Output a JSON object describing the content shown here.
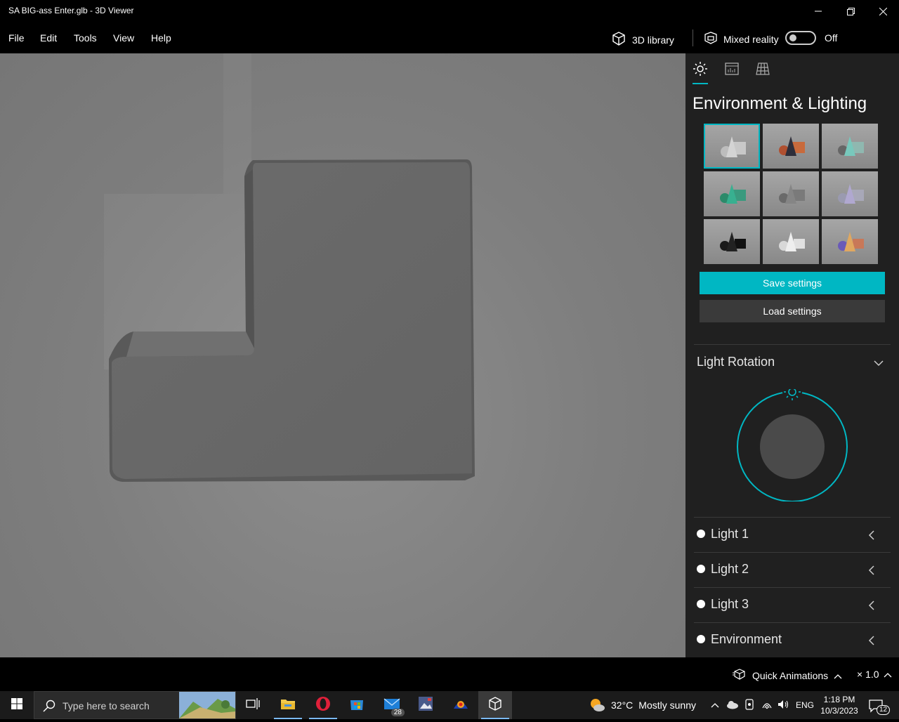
{
  "window": {
    "title": "SA BIG-ass Enter.glb - 3D Viewer"
  },
  "menu": {
    "file": "File",
    "edit": "Edit",
    "tools": "Tools",
    "view": "View",
    "help": "Help"
  },
  "toolbar": {
    "library_label": "3D library",
    "mixed_reality_label": "Mixed reality",
    "mixed_reality_state": "Off"
  },
  "panel": {
    "title": "Environment & Lighting",
    "save_label": "Save settings",
    "load_label": "Load settings",
    "light_rotation_label": "Light Rotation",
    "lights": [
      {
        "label": "Light 1"
      },
      {
        "label": "Light 2"
      },
      {
        "label": "Light 3"
      },
      {
        "label": "Environment"
      }
    ]
  },
  "statusbar": {
    "quick_animations": "Quick Animations",
    "speed": "× 1.0"
  },
  "taskbar": {
    "search_placeholder": "Type here to search",
    "mail_badge": "28",
    "weather_temp": "32°C",
    "weather_desc": "Mostly sunny",
    "lang": "ENG",
    "time": "1:18 PM",
    "date": "10/3/2023",
    "notif_count": "12"
  },
  "colors": {
    "accent": "#00b7c3",
    "panel_bg": "#202020",
    "viewport_bg": "#828282"
  }
}
